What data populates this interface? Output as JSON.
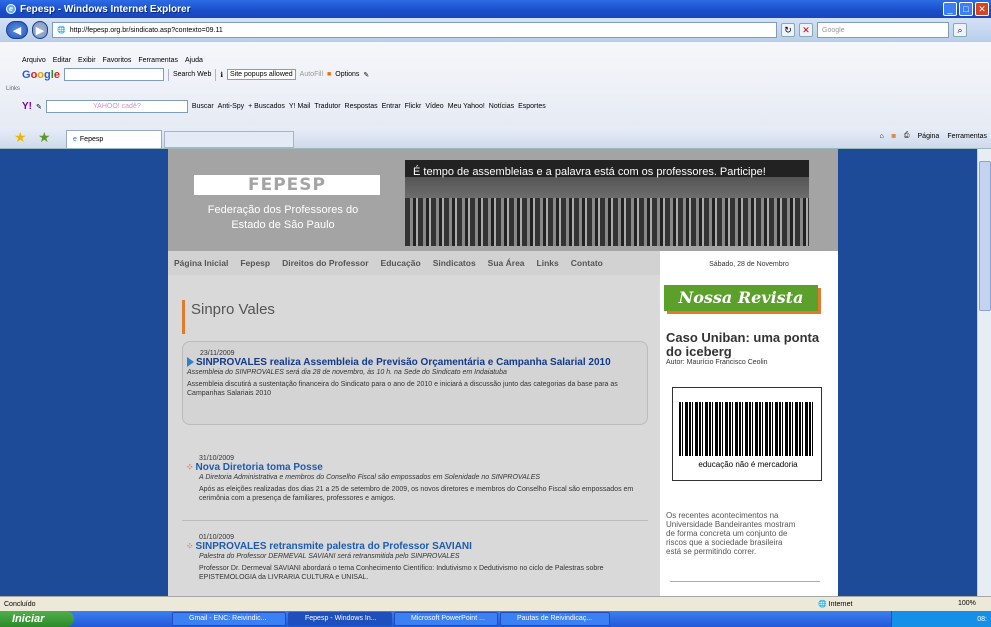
{
  "window": {
    "title": "Fepesp - Windows Internet Explorer"
  },
  "address": {
    "url": "http://fepesp.org.br/sindicato.asp?contexto=09.11",
    "search_placeholder": "Google"
  },
  "menu": [
    "Arquivo",
    "Editar",
    "Exibir",
    "Favoritos",
    "Ferramentas",
    "Ajuda"
  ],
  "google_toolbar": {
    "search_web": "Search Web",
    "popups": "Site popups allowed",
    "autofill": "AutoFill",
    "options": "Options"
  },
  "links_label": "Links",
  "yahoo_toolbar": {
    "placeholder": "YAHOO! cadê?",
    "items": [
      "Buscar",
      "Anti-Spy",
      "+ Buscados",
      "Y! Mail",
      "Tradutor",
      "Respostas",
      "Entrar",
      "Flickr",
      "Vídeo",
      "Meu Yahoo!",
      "Notícias",
      "Esportes"
    ]
  },
  "tabs": {
    "active": "Fepesp"
  },
  "right_tools": {
    "page": "Página",
    "tools": "Ferramentas"
  },
  "site": {
    "logo": "FEPESP",
    "federation": "Federação dos Professores do Estado de São Paulo",
    "banner_text": "É tempo de assembleias e a palavra está com os professores. Participe!",
    "nav": [
      "Página Inicial",
      "Fepesp",
      "Direitos do Professor",
      "Educação",
      "Sindicatos",
      "Sua Área",
      "Links",
      "Contato"
    ],
    "page_title": "Sinpro Vales",
    "news": [
      {
        "date": "23/11/2009",
        "title": "SINPROVALES realiza Assembleia de Previsão Orçamentária e Campanha Salarial 2010",
        "subtitle": "Assembleia do SINPROVALES será dia 28 de novembro, às 10 h. na Sede do Sindicato em Indaiatuba",
        "body": "Assembleia discutirá a sustentação financeira do Sindicato para o ano de 2010 e iniciará a discussão junto das categorias da base para as Campanhas Salariais 2010"
      },
      {
        "date": "31/10/2009",
        "title": "Nova Diretoria toma Posse",
        "subtitle": "A Diretoria Administrativa e membros do Conselho Fiscal são empossados em Solenidade no SINPROVALES",
        "body": "Após as eleições realizadas dos dias 21 a 25 de setembro de 2009, os novos diretores e membros do Conselho Fiscal são empossados em cerimônia com a presença de familiares, professores e amigos."
      },
      {
        "date": "01/10/2009",
        "title": "SINPROVALES retransmite palestra do Professor SAVIANI",
        "subtitle": "Palestra do Professor DERMEVAL SAVIANI será retransmitida pelo SINPROVALES",
        "body": "Professor Dr. Dermeval SAVIANI abordará o tema Conhecimento Científico: Indutivismo x Dedutivismo no ciclo de Palestras sobre EPISTEMOLOGIA da LIVRARIA CULTURA e UNISAL."
      }
    ],
    "sidebar": {
      "date": "Sábado, 28 de Novembro",
      "revista": "Nossa Revista",
      "headline": "Caso Uniban: uma ponta do iceberg",
      "author": "Autor: Maurício Francisco Ceolin",
      "barcode_text": "educação não é mercadoria",
      "description": "Os recentes acontecimentos na Universidade Bandeirantes mostram de forma concreta um conjunto de riscos que a sociedade brasileira está se permitindo correr."
    }
  },
  "status": {
    "text": "Concluído",
    "zone": "Internet",
    "zoom": "100%"
  },
  "taskbar": {
    "start": "Iniciar",
    "items": [
      "Gmail - ENC: Reivindic...",
      "Fepesp - Windows In...",
      "Microsoft PowerPoint ...",
      "Pautas de Reivindicaç..."
    ],
    "clock": "08:"
  }
}
